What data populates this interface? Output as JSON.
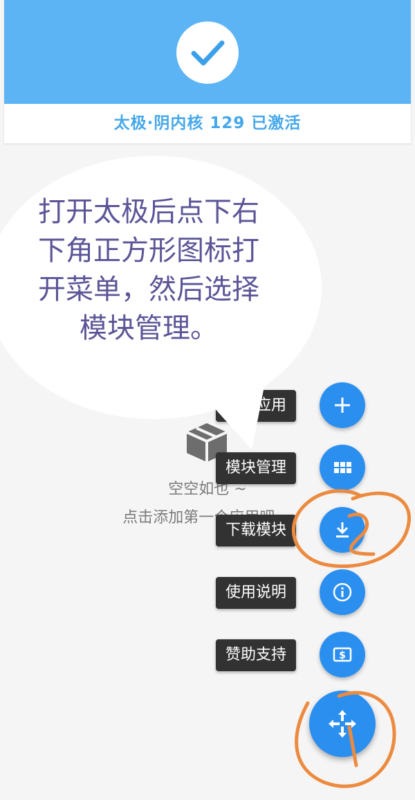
{
  "status": {
    "text": "太极·阴内核 129 已激活",
    "accent_color": "#5cb4f5",
    "icon": "check-icon"
  },
  "empty_state": {
    "line1": "空空如也 ~",
    "line2": "点击添加第一个应用吧 ~",
    "icon": "box-icon"
  },
  "annotation_bubble": {
    "text": "打开太极后点下右下角正方形图标打开菜单，然后选择模块管理。"
  },
  "fab_menu": {
    "items": [
      {
        "label": "添加应用",
        "icon": "plus-icon"
      },
      {
        "label": "模块管理",
        "icon": "grid-icon"
      },
      {
        "label": "下载模块",
        "icon": "download-icon"
      },
      {
        "label": "使用说明",
        "icon": "info-icon"
      },
      {
        "label": "赞助支持",
        "icon": "dollar-icon"
      }
    ],
    "main_icon": "move-icon",
    "fab_color": "#2b8ff0"
  },
  "handwritten_marks": [
    "1",
    "2"
  ]
}
